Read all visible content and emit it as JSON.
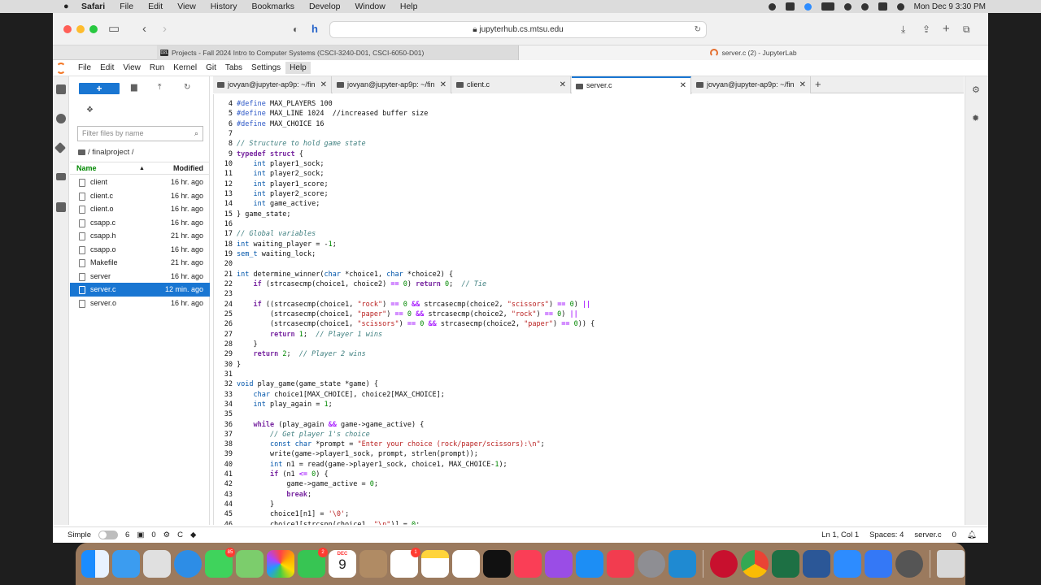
{
  "menubar": {
    "app": "Safari",
    "items": [
      "File",
      "Edit",
      "View",
      "History",
      "Bookmarks",
      "Develop",
      "Window",
      "Help"
    ],
    "datetime": "Mon Dec 9  3:30 PM"
  },
  "browser": {
    "url": "jupyterhub.cs.mtsu.edu",
    "tab1": "Projects - Fall 2024 Intro to Computer Systems (CSCI-3240-D01, CSCI-6050-D01)",
    "tab1_favicon": "D2L",
    "tab2": "server.c (2) - JupyterLab"
  },
  "jupyter": {
    "menu": [
      "File",
      "Edit",
      "View",
      "Run",
      "Kernel",
      "Git",
      "Tabs",
      "Settings",
      "Help"
    ],
    "new_button": "+",
    "filter_placeholder": "Filter files by name",
    "breadcrumb": "/ finalproject /",
    "col_name": "Name",
    "col_modified": "Modified",
    "files": [
      {
        "name": "client",
        "modified": "16 hr. ago"
      },
      {
        "name": "client.c",
        "modified": "16 hr. ago"
      },
      {
        "name": "client.o",
        "modified": "16 hr. ago"
      },
      {
        "name": "csapp.c",
        "modified": "16 hr. ago"
      },
      {
        "name": "csapp.h",
        "modified": "21 hr. ago"
      },
      {
        "name": "csapp.o",
        "modified": "16 hr. ago"
      },
      {
        "name": "Makefile",
        "modified": "21 hr. ago"
      },
      {
        "name": "server",
        "modified": "16 hr. ago"
      },
      {
        "name": "server.c",
        "modified": "12 min. ago"
      },
      {
        "name": "server.o",
        "modified": "16 hr. ago"
      }
    ],
    "tabs": [
      "jovyan@jupyter-ap9p: ~/fin",
      "jovyan@jupyter-ap9p: ~/fin",
      "client.c",
      "server.c",
      "jovyan@jupyter-ap9p: ~/fin"
    ],
    "status": {
      "mode": "Simple",
      "n1": "6",
      "n2": "0",
      "lang": "C",
      "position": "Ln 1, Col 1",
      "spaces": "Spaces: 4",
      "file": "server.c",
      "bell_count": "0"
    }
  },
  "code": {
    "first_line": 4,
    "lines": [
      "#define MAX_PLAYERS 100",
      "#define MAX_LINE 1024  //increased buffer size",
      "#define MAX_CHOICE 16",
      "",
      "// Structure to hold game state",
      "typedef struct {",
      "    int player1_sock;",
      "    int player2_sock;",
      "    int player1_score;",
      "    int player2_score;",
      "    int game_active;",
      "} game_state;",
      "",
      "// Global variables",
      "int waiting_player = -1;",
      "sem_t waiting_lock;",
      "",
      "int determine_winner(char *choice1, char *choice2) {",
      "    if (strcasecmp(choice1, choice2) == 0) return 0;  // Tie",
      "",
      "    if ((strcasecmp(choice1, \"rock\") == 0 && strcasecmp(choice2, \"scissors\") == 0) ||",
      "        (strcasecmp(choice1, \"paper\") == 0 && strcasecmp(choice2, \"rock\") == 0) ||",
      "        (strcasecmp(choice1, \"scissors\") == 0 && strcasecmp(choice2, \"paper\") == 0)) {",
      "        return 1;  // Player 1 wins",
      "    }",
      "    return 2;  // Player 2 wins",
      "}",
      "",
      "void play_game(game_state *game) {",
      "    char choice1[MAX_CHOICE], choice2[MAX_CHOICE];",
      "    int play_again = 1;",
      "",
      "    while (play_again && game->game_active) {",
      "        // Get player 1's choice",
      "        const char *prompt = \"Enter your choice (rock/paper/scissors):\\n\";",
      "        write(game->player1_sock, prompt, strlen(prompt));",
      "        int n1 = read(game->player1_sock, choice1, MAX_CHOICE-1);",
      "        if (n1 <= 0) {",
      "            game->game_active = 0;",
      "            break;",
      "        }",
      "        choice1[n1] = '\\0';",
      "        choice1[strcspn(choice1, \"\\n\")] = 0;"
    ]
  },
  "dock": {
    "badges": {
      "messages": "85",
      "facetime": "2",
      "reminders": "1"
    },
    "calendar": {
      "month": "DEC",
      "day": "9"
    }
  },
  "colors": {
    "accent": "#1976d2",
    "keyword": "#7928a1",
    "define": "#2a56c6",
    "comment": "#408080",
    "string": "#ba2121",
    "number": "#008800"
  }
}
